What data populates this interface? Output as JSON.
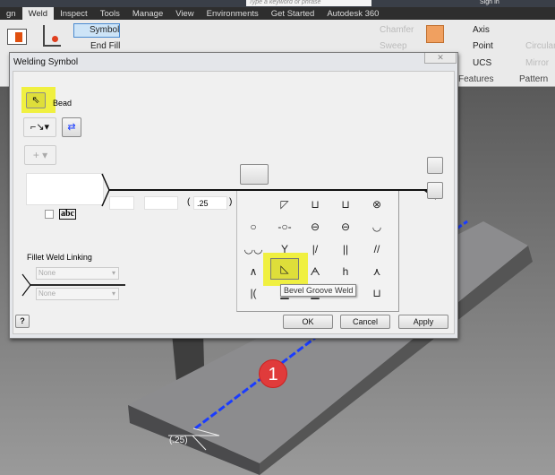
{
  "topbar": {
    "search_placeholder": "Type a keyword or phrase",
    "sign_in": "Sign In"
  },
  "tabs": [
    "gn",
    "Weld",
    "Inspect",
    "Tools",
    "Manage",
    "View",
    "Environments",
    "Get Started",
    "Autodesk 360"
  ],
  "ribbon": {
    "symbol": "Symbol",
    "end_fill": "End Fill",
    "chamfer": "Chamfer",
    "sweep": "Sweep",
    "axis": "Axis",
    "point": "Point",
    "ucs": "UCS",
    "circular": "Circular",
    "mirror": "Mirror",
    "features": "Features",
    "pattern": "Pattern"
  },
  "dialog": {
    "title": "Welding Symbol",
    "close": "✕",
    "bead_label": "Bead",
    "abc": "abc",
    "paren_open": "(",
    "paren_close": ")",
    "size_value": ".25",
    "fillet_weld_linking": "Fillet Weld Linking",
    "linking_top": "None",
    "linking_bottom": "None",
    "help": "?",
    "ok": "OK",
    "cancel": "Cancel",
    "apply": "Apply"
  },
  "palette": {
    "tooltip": "Bevel Groove Weld",
    "selected": "Bevel Groove Weld",
    "symbols": [
      "◸",
      "⊔",
      "⊔",
      "⊗",
      "○",
      "-○-",
      "⊖",
      "⊖",
      "◡",
      "◡◡",
      "Y",
      "|/",
      "||",
      "//",
      "∧",
      "◺",
      "ᗅ",
      "h",
      "⋏",
      "|(",
      "▁",
      "▁",
      "⊔"
    ]
  },
  "viewport": {
    "badge": "1",
    "dimension": "(.25)"
  },
  "colors": {
    "highlight": "#f0f040",
    "weld_bead": "#1a3cff",
    "badge": "#e03b3b"
  }
}
